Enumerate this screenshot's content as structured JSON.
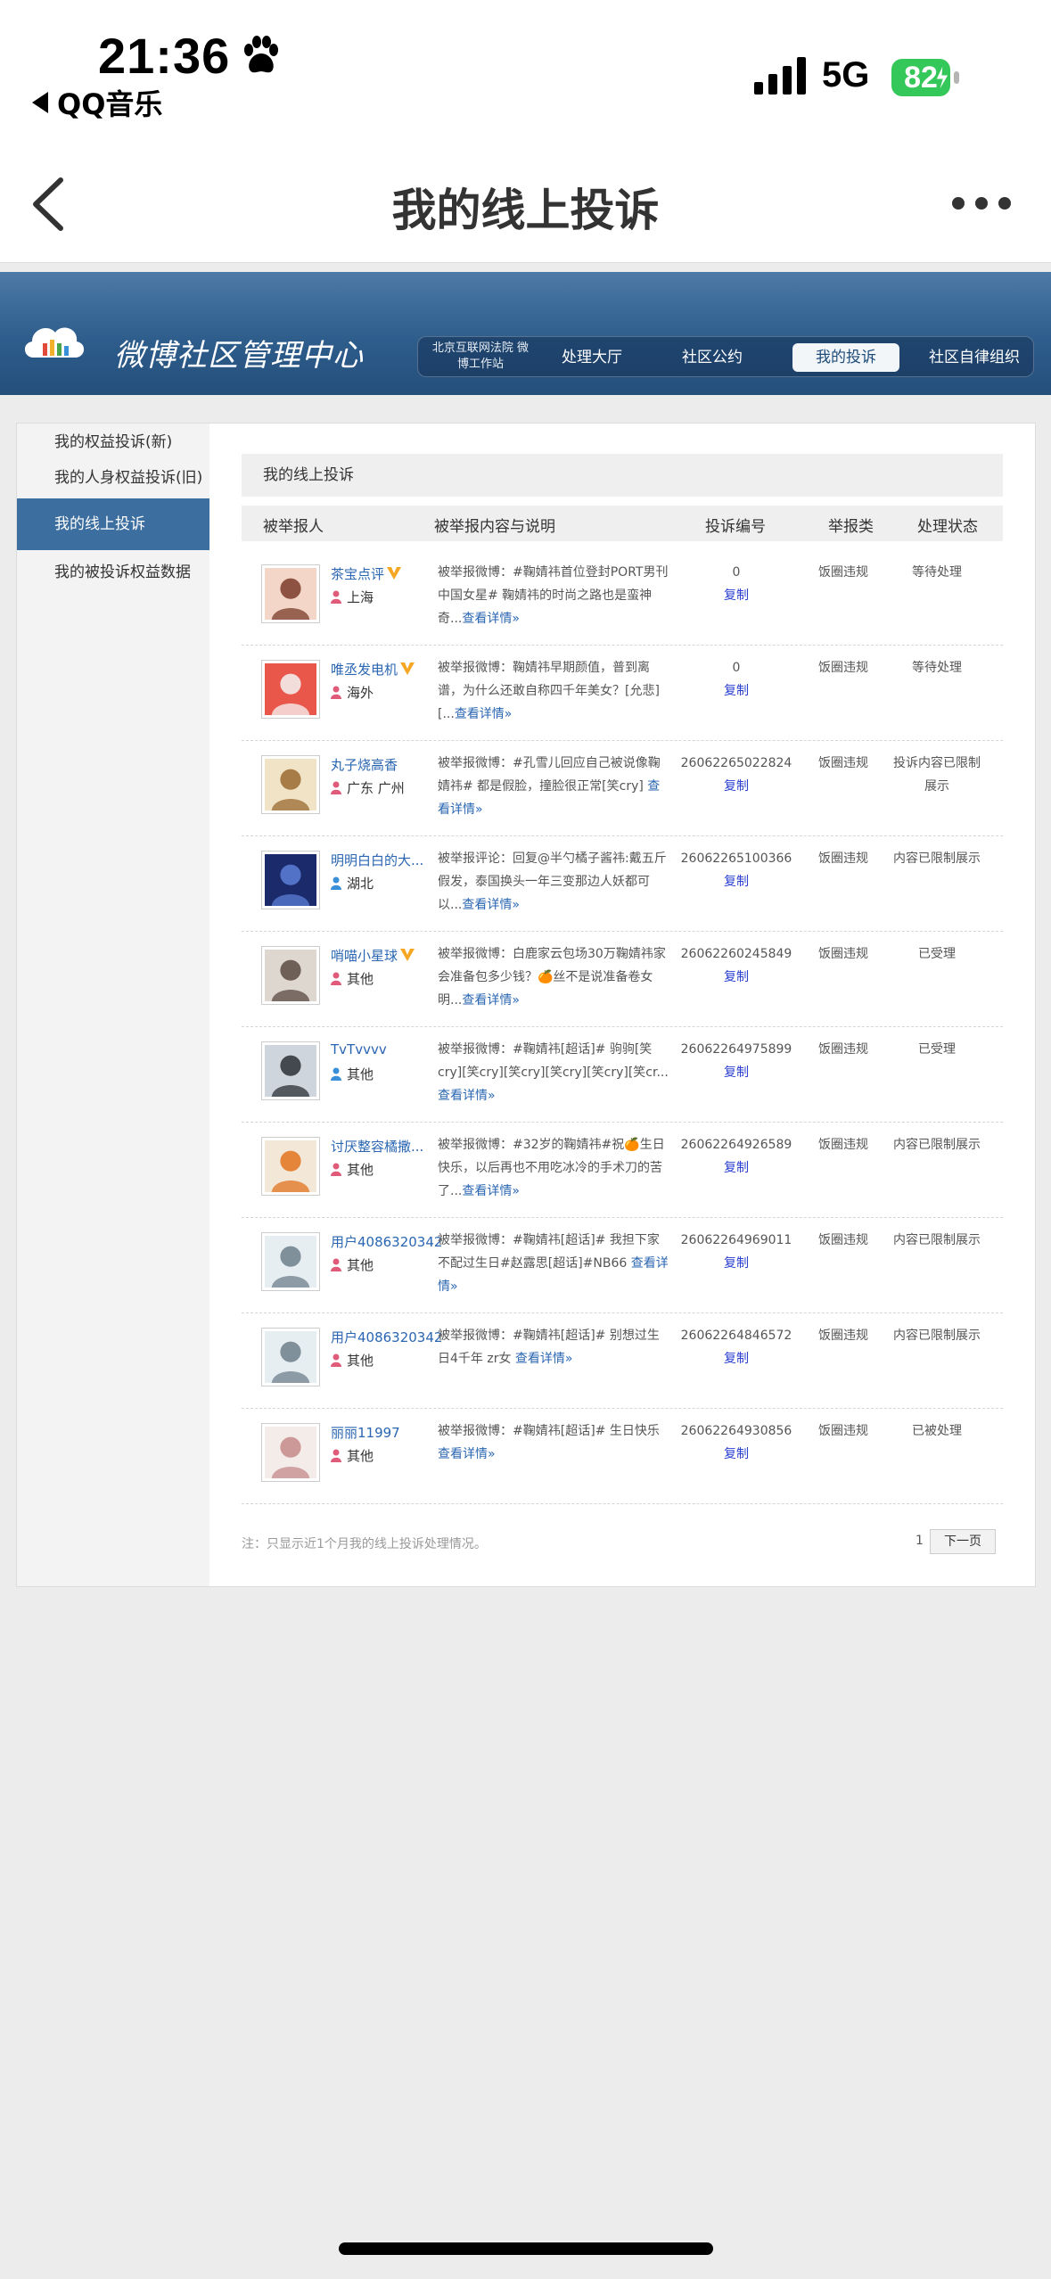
{
  "status_bar": {
    "time": "21:36",
    "back_app": "QQ音乐",
    "network": "5G",
    "battery": "82"
  },
  "nav": {
    "title": "我的线上投诉"
  },
  "header": {
    "brand": "微博社区管理中心",
    "court_label": "北京互联网法院 微博工作站",
    "menu": [
      "处理大厅",
      "社区公约",
      "我的投诉",
      "社区自律组织"
    ],
    "active_menu": "我的投诉"
  },
  "sidebar": {
    "items": [
      "我的权益投诉(新)",
      "我的人身权益投诉(旧)",
      "我的线上投诉",
      "我的被投诉权益数据"
    ],
    "active": "我的线上投诉"
  },
  "table": {
    "box_title": "我的线上投诉",
    "headers": [
      "被举报人",
      "被举报内容与说明",
      "投诉编号",
      "举报类",
      "处理状态"
    ],
    "copy_label": "复制",
    "rows": [
      {
        "name": "茶宝点评",
        "vip": true,
        "gender": "female",
        "location": "上海",
        "desc": "被举报微博：#鞠婧祎首位登封PORT男刊中国女星# 鞠婧祎的时尚之路也是蛮神奇...",
        "link": "查看详情»",
        "id": "0",
        "type": "饭圈违规",
        "status": "等待处理"
      },
      {
        "name": "唯丞发电机",
        "vip": true,
        "gender": "female",
        "location": "海外",
        "desc": "被举报微博：鞠婧祎早期颜值，普到离谱，为什么还敢自称四千年美女？[允悲][...",
        "link": "查看详情»",
        "id": "0",
        "type": "饭圈违规",
        "status": "等待处理"
      },
      {
        "name": "丸子烧高香",
        "vip": false,
        "gender": "female",
        "location": "广东 广州",
        "desc": "被举报微博：#孔雪儿回应自己被说像鞠婧祎# 都是假脸，撞脸很正常[笑cry] ",
        "link": "查看详情»",
        "id": "26062265022824",
        "type": "饭圈违规",
        "status": "投诉内容已限制展示"
      },
      {
        "name": "明明白白的大...",
        "vip": false,
        "gender": "male",
        "location": "湖北",
        "desc": "被举报评论：回复@半勺橘子酱祎:戴五斤假发，泰国换头一年三变那边人妖都可以...",
        "link": "查看详情»",
        "id": "26062265100366",
        "type": "饭圈违规",
        "status": "内容已限制展示"
      },
      {
        "name": "哨喵小星球",
        "vip": true,
        "gender": "female",
        "location": "其他",
        "desc": "被举报微博：白鹿家云包场30万鞠婧祎家会准备包多少钱？🍊丝不是说准备卷女明...",
        "link": "查看详情»",
        "id": "26062260245849",
        "type": "饭圈违规",
        "status": "已受理"
      },
      {
        "name": "TvTvvvv",
        "vip": false,
        "gender": "male",
        "location": "其他",
        "desc": "被举报微博：#鞠婧祎[超话]# 驹驹[笑cry][笑cry][笑cry][笑cry][笑cry][笑cr...",
        "link": "查看详情»",
        "id": "26062264975899",
        "type": "饭圈违规",
        "status": "已受理"
      },
      {
        "name": "讨厌整容橘撒...",
        "vip": false,
        "gender": "female",
        "location": "其他",
        "desc": "被举报微博：#32岁的鞠婧祎#祝🍊生日快乐，以后再也不用吃冰冷的手术刀的苦了...",
        "link": "查看详情»",
        "id": "26062264926589",
        "type": "饭圈违规",
        "status": "内容已限制展示"
      },
      {
        "name": "用户4086320342",
        "vip": false,
        "gender": "female",
        "location": "其他",
        "desc": "被举报微博：#鞠婧祎[超话]# 我担下家不配过生日#赵露思[超话]#NB66 ",
        "link": "查看详情»",
        "id": "26062264969011",
        "type": "饭圈违规",
        "status": "内容已限制展示"
      },
      {
        "name": "用户4086320342",
        "vip": false,
        "gender": "female",
        "location": "其他",
        "desc": "被举报微博：#鞠婧祎[超话]# 别想过生日4千年 zr女 ",
        "link": "查看详情»",
        "id": "26062264846572",
        "type": "饭圈违规",
        "status": "内容已限制展示"
      },
      {
        "name": "丽丽11997",
        "vip": false,
        "gender": "female",
        "location": "其他",
        "desc": "被举报微博：#鞠婧祎[超话]# 生日快乐 ",
        "link": "查看详情»",
        "id": "26062264930856",
        "type": "饭圈违规",
        "status": "已被处理"
      }
    ]
  },
  "footer": {
    "note": "注：只显示近1个月我的线上投诉处理情况。",
    "page": "1",
    "next": "下一页"
  },
  "colors": {
    "banner": "#2e5d8c",
    "sidebar_active": "#3c6e9f",
    "link": "#2a66b2",
    "copy": "#2a3fd0",
    "battery": "#34c759"
  }
}
